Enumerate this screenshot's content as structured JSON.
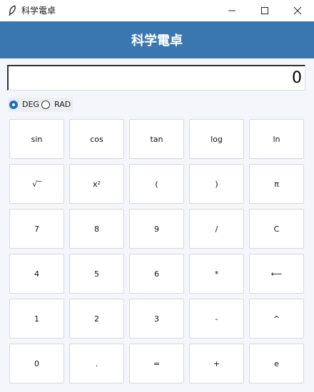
{
  "window": {
    "title": "科学電卓",
    "icon": "feather-icon"
  },
  "header": {
    "title": "科学電卓",
    "background": "#3a77b0"
  },
  "display": {
    "value": "0"
  },
  "mode": {
    "selected": "DEG",
    "options": [
      "DEG",
      "RAD"
    ]
  },
  "keypad": {
    "keys": [
      "sin",
      "cos",
      "tan",
      "log",
      "ln",
      "√‾",
      "x²",
      "(",
      ")",
      "π",
      "7",
      "8",
      "9",
      "/",
      "C",
      "4",
      "5",
      "6",
      "*",
      "⟵",
      "1",
      "2",
      "3",
      "-",
      "^",
      "0",
      ".",
      "=",
      "+",
      "e"
    ]
  }
}
